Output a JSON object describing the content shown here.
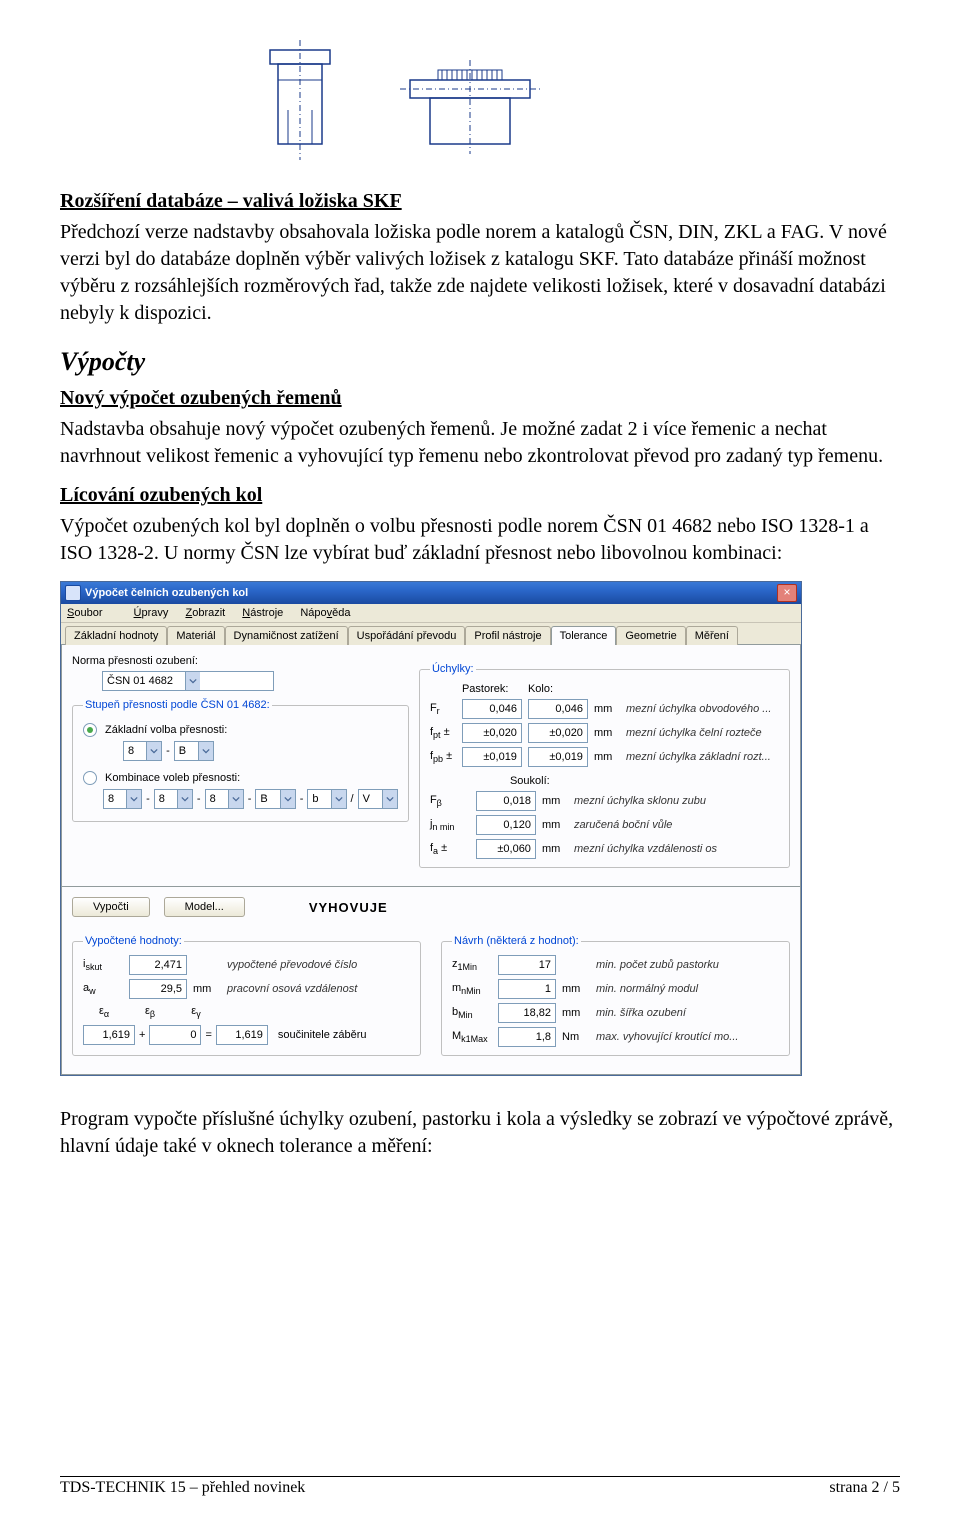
{
  "drawings": {
    "alt1": "technical-drawing-1",
    "alt2": "technical-drawing-2"
  },
  "s1": {
    "title": "Rozšíření databáze – valivá ložiska SKF",
    "text": "Předchozí verze nadstavby obsahovala ložiska podle norem a katalogů ČSN, DIN, ZKL a FAG. V nové verzi byl do databáze doplněn výběr valivých ložisek z katalogu SKF. Tato databáze přináší možnost výběru z rozsáhlejších rozměrových řad, takže zde najdete velikosti ložisek, které v dosavadní databázi nebyly k dispozici."
  },
  "s2": {
    "title": "Výpočty"
  },
  "s3": {
    "title": "Nový výpočet ozubených řemenů",
    "text": "Nadstavba obsahuje nový výpočet ozubených řemenů. Je možné zadat 2 i více řemenic a nechat navrhnout velikost řemenic a vyhovující typ řemenu nebo zkontrolovat převod pro zadaný typ řemenu."
  },
  "s4": {
    "title": "Lícování ozubených kol",
    "text": "Výpočet ozubených kol byl doplněn o volbu přesnosti podle norem ČSN 01 4682 nebo ISO 1328-1 a ISO 1328-2. U normy ČSN lze vybírat buď základní přesnost nebo libovolnou kombinaci:"
  },
  "dialog": {
    "title": "Výpočet čelních ozubených kol",
    "menu": [
      "Soubor",
      "Úpravy",
      "Zobrazit",
      "Nástroje",
      "Nápověda"
    ],
    "tabs": [
      "Základní hodnoty",
      "Materiál",
      "Dynamičnost zatížení",
      "Uspořádání převodu",
      "Profil nástroje",
      "Tolerance",
      "Geometrie",
      "Měření"
    ],
    "active_tab": 5,
    "norma_label": "Norma přesnosti ozubení:",
    "norma_value": "ČSN 01 4682",
    "stupen_legend": "Stupeň přesnosti podle ČSN 01 4682:",
    "radio1": "Základní volba přesnosti:",
    "radio2": "Kombinace voleb přesnosti:",
    "basic": {
      "a": "8",
      "b": "B"
    },
    "combo_row": [
      "8",
      "8",
      "8",
      "B",
      "b",
      "V"
    ],
    "dev": {
      "legend": "Úchylky:",
      "hdr_p": "Pastorek:",
      "hdr_k": "Kolo:",
      "rows": [
        {
          "sym": "F_r",
          "p": "0,046",
          "k": "0,046",
          "u": "mm",
          "d": "mezní úchylka obvodového ..."
        },
        {
          "sym": "f_pt ±",
          "p": "±0,020",
          "k": "±0,020",
          "u": "mm",
          "d": "mezní úchylka čelní rozteče"
        },
        {
          "sym": "f_pb ±",
          "p": "±0,019",
          "k": "±0,019",
          "u": "mm",
          "d": "mezní úchylka základní rozt..."
        }
      ],
      "souk": "Soukolí:",
      "souk_rows": [
        {
          "sym": "F_β",
          "v": "0,018",
          "u": "mm",
          "d": "mezní úchylka sklonu zubu"
        },
        {
          "sym": "j_n min",
          "v": "0,120",
          "u": "mm",
          "d": "zaručená boční vůle"
        },
        {
          "sym": "f_a ±",
          "v": "±0,060",
          "u": "mm",
          "d": "mezní úchylka vzdálenosti os"
        }
      ]
    },
    "buttons": {
      "calc": "Vypočti",
      "model": "Model..."
    },
    "result": "VYHOVUJE",
    "out_left": {
      "legend": "Vypočtené hodnoty:",
      "rows": [
        {
          "sym": "i_skut",
          "v": "2,471",
          "u": "",
          "d": "vypočtené převodové číslo"
        },
        {
          "sym": "a_w",
          "v": "29,5",
          "u": "mm",
          "d": "pracovní osová vzdálenost"
        }
      ],
      "coef": {
        "h": [
          "ε_α",
          "ε_β",
          "ε_γ"
        ],
        "a": "1,619",
        "b": "0",
        "r": "1,619",
        "d": "součinitele záběru"
      }
    },
    "out_right": {
      "legend": "Návrh (některá z hodnot):",
      "rows": [
        {
          "sym": "z_1Min",
          "v": "17",
          "u": "",
          "d": "min. počet zubů pastorku"
        },
        {
          "sym": "m_nMin",
          "v": "1",
          "u": "mm",
          "d": "min. normálný modul"
        },
        {
          "sym": "b_Min",
          "v": "18,82",
          "u": "mm",
          "d": "min. šířka ozubení"
        },
        {
          "sym": "M_k1Max",
          "v": "1,8",
          "u": "Nm",
          "d": "max. vyhovující kroutící mo..."
        }
      ]
    }
  },
  "closing": "Program vypočte příslušné úchylky ozubení, pastorku i kola a výsledky se zobrazí ve výpočtové zprávě, hlavní údaje také v oknech tolerance a měření:",
  "footer": {
    "left": "TDS-TECHNIK 15 – přehled novinek",
    "right": "strana 2 / 5"
  }
}
